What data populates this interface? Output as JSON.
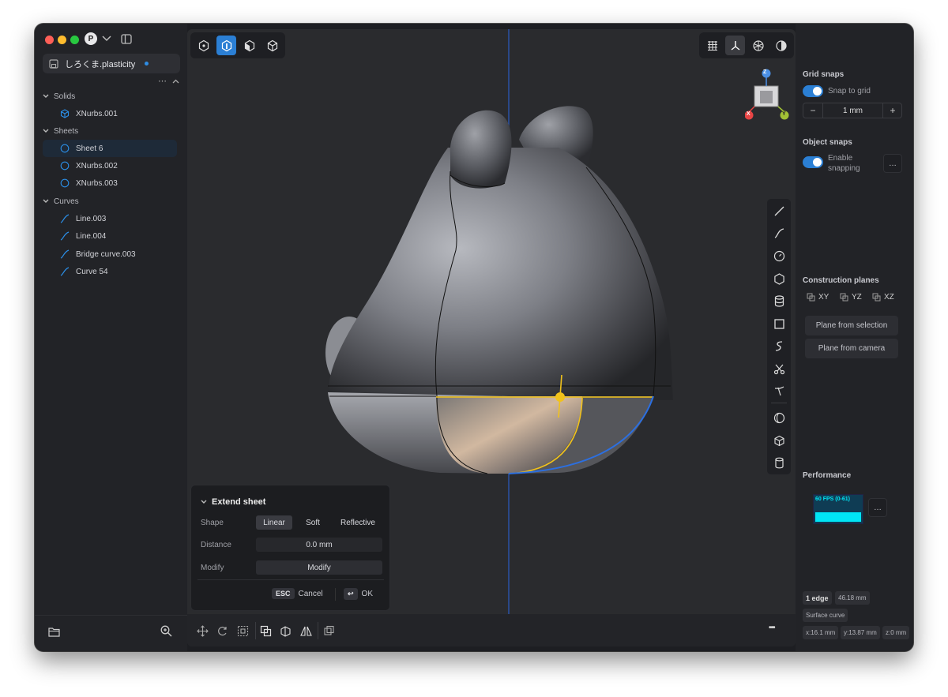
{
  "window": {
    "profile_initial": "P"
  },
  "file": {
    "name": "しろくま.plasticity"
  },
  "outline": {
    "solids_label": "Solids",
    "solids": [
      "XNurbs.001"
    ],
    "sheets_label": "Sheets",
    "sheets": [
      "Sheet 6",
      "XNurbs.002",
      "XNurbs.003"
    ],
    "curves_label": "Curves",
    "curves": [
      "Line.003",
      "Line.004",
      "Bridge curve.003",
      "Curve 54"
    ],
    "more_label": "⋯"
  },
  "viewcube": {
    "z": "Z",
    "x": "X",
    "y": "Y"
  },
  "extend_sheet": {
    "title": "Extend sheet",
    "shape_label": "Shape",
    "shape_options": [
      "Linear",
      "Soft",
      "Reflective"
    ],
    "shape_selected": "Linear",
    "distance_label": "Distance",
    "distance_value": "0.0 mm",
    "modify_label": "Modify",
    "modify_button": "Modify",
    "esc_key": "ESC",
    "cancel_label": "Cancel",
    "enter_key": "↩",
    "ok_label": "OK"
  },
  "bottom_toolbar": {
    "more_label": "•••"
  },
  "grid_snaps": {
    "title": "Grid snaps",
    "snap_label": "Snap to grid",
    "minus": "−",
    "value": "1 mm",
    "plus": "+"
  },
  "object_snaps": {
    "title": "Object snaps",
    "enable_label_1": "Enable",
    "enable_label_2": "snapping",
    "more_label": "…"
  },
  "construction_planes": {
    "title": "Construction planes",
    "xy": "XY",
    "yz": "YZ",
    "xz": "XZ",
    "from_selection": "Plane from selection",
    "from_camera": "Plane from camera"
  },
  "performance": {
    "title": "Performance",
    "fps": "60 FPS (0-61)",
    "more_label": "…",
    "accent": "#00e5f5"
  },
  "status": {
    "selection": "1 edge",
    "length": "46.18 mm",
    "type": "Surface curve",
    "x": "x:16.1 mm",
    "y": "y:13.87 mm",
    "z": "z:0 mm"
  },
  "colors": {
    "accent": "#2b7fd4",
    "selection_curve": "#f1c21b",
    "edge_highlight": "#2c6fe0"
  }
}
